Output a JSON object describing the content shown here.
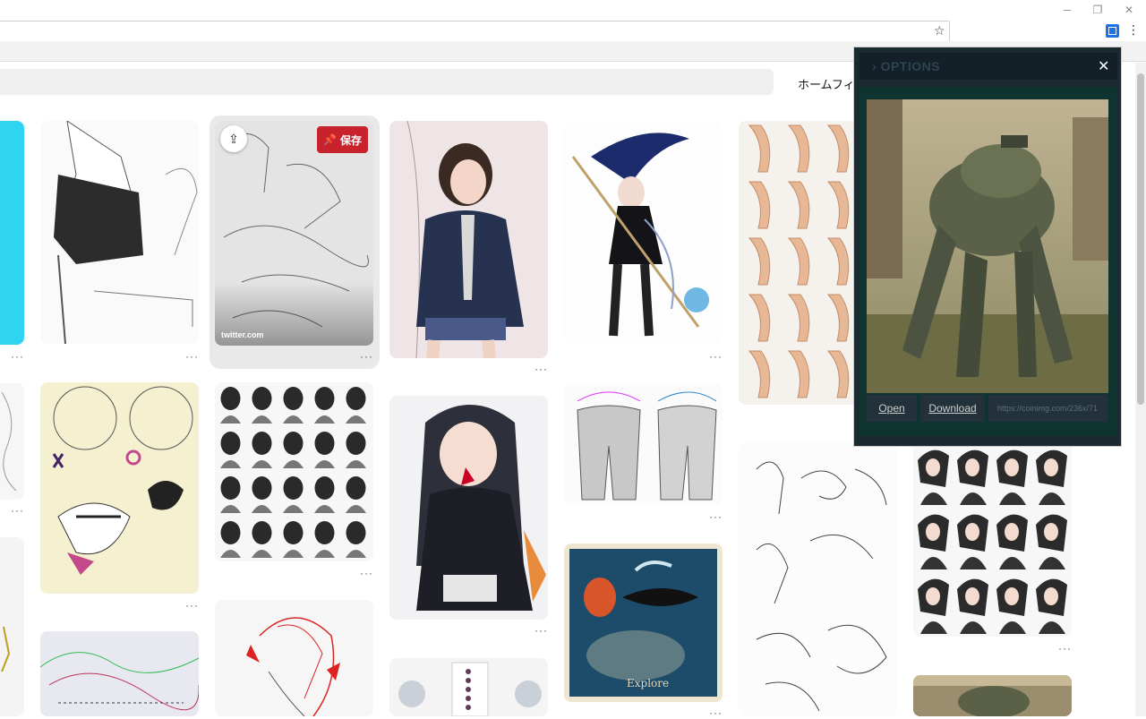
{
  "browser": {
    "window_controls": {
      "minimize": "─",
      "restore": "❐",
      "close": "✕"
    },
    "star_glyph": "☆",
    "menu_glyph": "⋮"
  },
  "page": {
    "home_feed_label": "ホームフィ",
    "pin_menu_glyph": "···",
    "hovered_pin": {
      "save_label": "保存",
      "source": "twitter.com"
    }
  },
  "options_popup": {
    "title": "OPTIONS",
    "chevron": "›",
    "close_glyph": "✕",
    "open_label": "Open",
    "download_label": "Download",
    "url_value": "https://coinimg.com/236x/71"
  },
  "colors": {
    "save_red": "#c8232c",
    "popup_bg": "#1b2a30",
    "cyan_pin": "#2fd4f0"
  }
}
